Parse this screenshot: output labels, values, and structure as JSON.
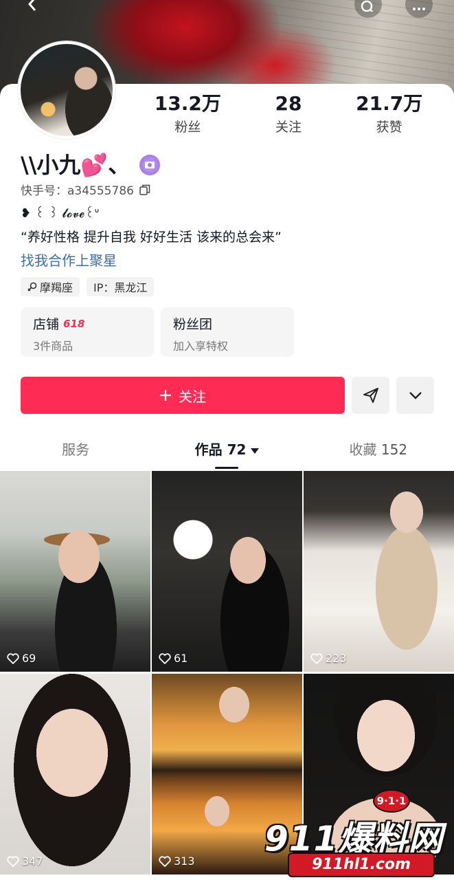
{
  "header": {
    "back_icon": "chevron-left-icon",
    "search_icon": "search-icon",
    "more_icon": "more-icon"
  },
  "profile": {
    "name": "\\\\小九💕、",
    "uid_label": "快手号：a34555786",
    "bio_line1": "❥ ꒰ ꒱ 𝓵𝓸𝓿𝓮꒰ᐡ",
    "bio_line2": "“养好性格 提升自我 好好生活 该来的总会来”",
    "coop_link": "找我合作上聚星"
  },
  "stats": [
    {
      "value": "13.2万",
      "label": "粉丝"
    },
    {
      "value": "28",
      "label": "关注"
    },
    {
      "value": "21.7万",
      "label": "获赞"
    }
  ],
  "tags": [
    {
      "icon": "zodiac-icon",
      "text": "摩羯座"
    },
    {
      "icon": "",
      "text": "IP：黑龙江"
    }
  ],
  "cards": [
    {
      "title": "店铺",
      "badge": "618",
      "sub": "3件商品"
    },
    {
      "title": "粉丝团",
      "badge": "",
      "sub": "加入享特权"
    }
  ],
  "actions": {
    "follow_label": "关注",
    "share_icon": "send-icon",
    "expand_icon": "chevron-down-icon"
  },
  "tabs": [
    {
      "label": "服务",
      "count": ""
    },
    {
      "label": "作品",
      "count": "72"
    },
    {
      "label": "收藏",
      "count": "152"
    }
  ],
  "posts": [
    {
      "likes": "69"
    },
    {
      "likes": "61"
    },
    {
      "likes": "223"
    },
    {
      "likes": "347"
    },
    {
      "likes": "313"
    },
    {
      "likes": ""
    }
  ],
  "watermark": {
    "badge": "9·1·1",
    "main": "911爆料网",
    "url": "911hl1.com"
  },
  "colors": {
    "accent": "#fe2c55",
    "link": "#3d6ea8"
  }
}
